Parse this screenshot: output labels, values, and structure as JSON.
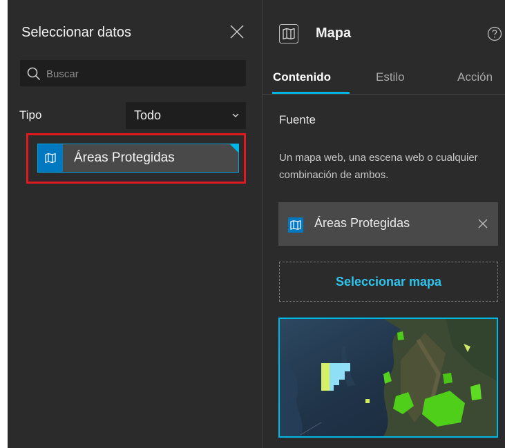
{
  "left_panel": {
    "title": "Seleccionar datos",
    "search": {
      "placeholder": "Buscar",
      "value": ""
    },
    "type_filter": {
      "label": "Tipo",
      "selected": "Todo"
    },
    "items": [
      {
        "label": "Áreas Protegidas",
        "icon": "map-icon"
      }
    ],
    "highlight_color": "#e0191f"
  },
  "right_panel": {
    "title": "Mapa",
    "tabs": [
      {
        "label": "Contenido",
        "active": true
      },
      {
        "label": "Estilo",
        "active": false
      },
      {
        "label": "Acción",
        "active": false
      }
    ],
    "section_label": "Fuente",
    "description": "Un mapa web, una escena web o cualquier combinación de ambos.",
    "source": {
      "label": "Áreas Protegidas",
      "icon": "map-icon"
    },
    "select_map_label": "Seleccionar mapa"
  },
  "colors": {
    "panel_bg": "#2b2b2b",
    "accent": "#00b8e6",
    "brand_blue": "#0079c1",
    "link": "#2fc4ee"
  }
}
